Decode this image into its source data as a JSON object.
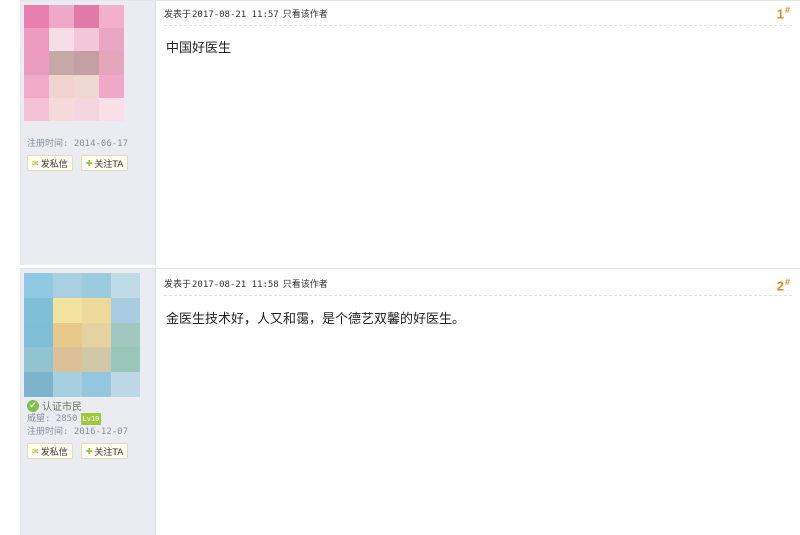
{
  "posts": [
    {
      "author_badge": "",
      "prestige": "",
      "register_date": "注册时间: 2014-06-17",
      "btn_message": "发私信",
      "btn_follow": "关注TA",
      "posted_label": "发表于",
      "posted_time": "2017-08-21 11:57",
      "view_author": "只看该作者",
      "floor": "1",
      "floor_mark": "#",
      "content": "中国好医生",
      "avatar_colors": [
        "#e87fb0",
        "#f0a8c8",
        "#e07aa8",
        "#f2b0cc",
        "#ee9ac0",
        "#f7dde6",
        "#f3c7d8",
        "#e9a6c2",
        "#e99cbf",
        "#c7a8a8",
        "#c49fa6",
        "#e4a6bb",
        "#f2aacb",
        "#f1d2cf",
        "#eed8cf",
        "#f0a8c8",
        "#f2c2d4",
        "#f6dad9",
        "#f4d6e0",
        "#f8dfe8"
      ]
    },
    {
      "author_badge": "认证市民",
      "prestige": "威望: 2850",
      "level_tag": "Lv10",
      "register_date": "注册时间: 2016-12-07",
      "btn_message": "发私信",
      "btn_follow": "关注TA",
      "posted_label": "发表于",
      "posted_time": "2017-08-21 11:58",
      "view_author": "只看该作者",
      "floor": "2",
      "floor_mark": "#",
      "content": "金医生技术好，人又和霭，是个德艺双馨的好医生。",
      "avatar_colors": [
        "#8fc9e4",
        "#a9cfe0",
        "#9ccbe0",
        "#c0dbe8",
        "#7fc0d8",
        "#f3e3a0",
        "#efd99a",
        "#a9cde0",
        "#7fbfd6",
        "#e8c98c",
        "#e5d2a0",
        "#a0c8c0",
        "#90c4d0",
        "#ddc098",
        "#d0c9a8",
        "#98c6b8",
        "#7cb4cc",
        "#a6cfe2",
        "#94c7df",
        "#bcd7e6"
      ]
    }
  ],
  "icons": {
    "mail": "✉",
    "plus": "✚",
    "check": "✔"
  }
}
